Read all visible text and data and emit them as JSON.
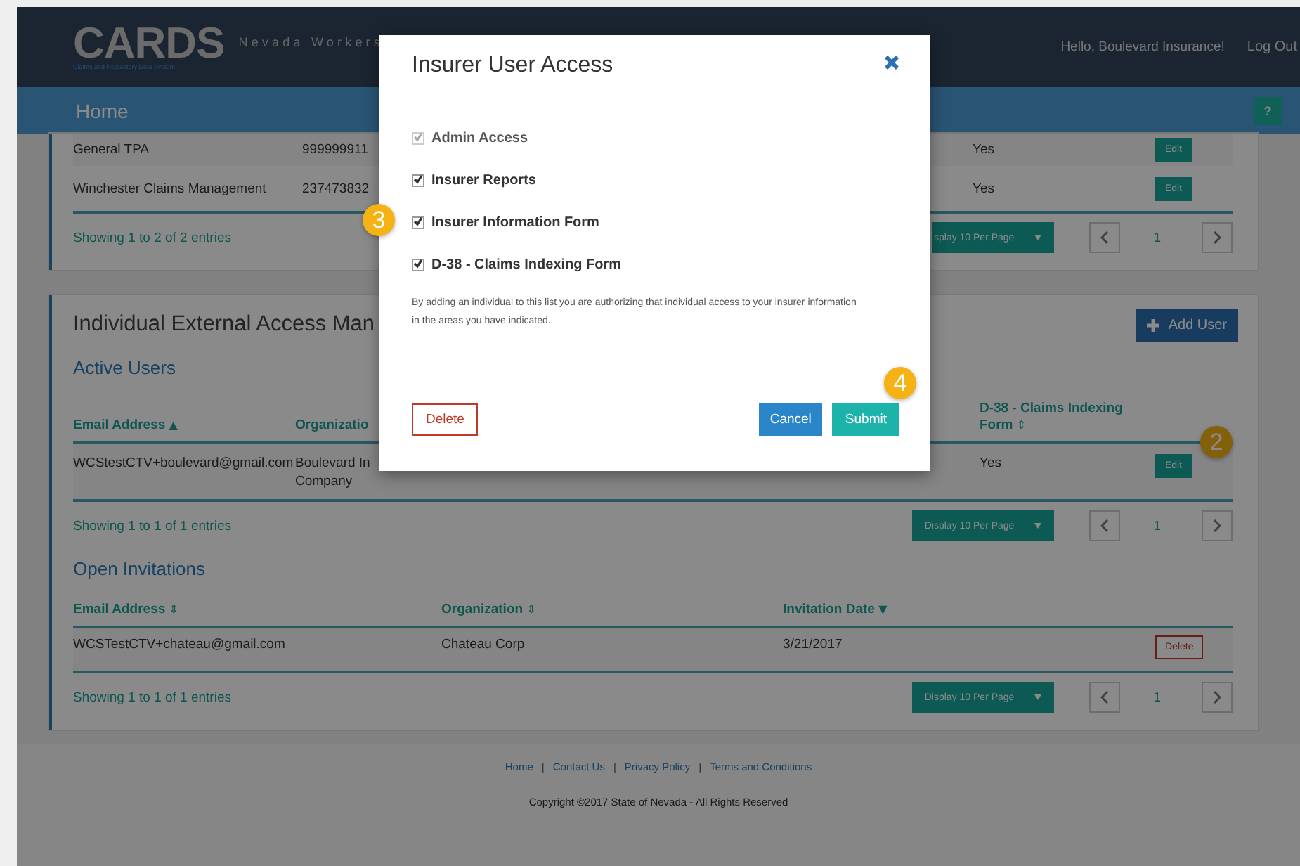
{
  "header": {
    "logo": "CARDS",
    "logo_subtitle": "Claims and Regulatory Data System",
    "site_title": "Nevada Workers",
    "greeting": "Hello, Boulevard Insurance!",
    "logout": "Log Out"
  },
  "nav": {
    "title": "Home",
    "help": "?"
  },
  "insurer_table": {
    "rows": [
      {
        "name": "General TPA",
        "number": "999999911",
        "access": "Yes",
        "action": "Edit"
      },
      {
        "name": "Winchester Claims Management",
        "number": "237473832",
        "access": "Yes",
        "action": "Edit"
      }
    ],
    "summary": "Showing 1 to 2 of 2 entries",
    "page_size": "splay 10 Per Page",
    "page": "1"
  },
  "external_access": {
    "title": "Individual External Access Man",
    "add_button": "Add User",
    "active_users": {
      "heading": "Active Users",
      "columns": [
        {
          "label": "Email Address",
          "sort_icon": "▲"
        },
        {
          "label": "Organizatio"
        },
        {
          "label": "D-38 - Claims Indexing Form",
          "sort_icon": "⇕"
        }
      ],
      "rows": [
        {
          "email": "WCStestCTV+boulevard@gmail.com",
          "organization": [
            "Boulevard In",
            "Company"
          ],
          "d38": "Yes",
          "action": "Edit",
          "callout": "2"
        }
      ],
      "summary": "Showing 1 to 1 of 1 entries",
      "page_size": "Display 10 Per Page",
      "page": "1"
    },
    "open_invitations": {
      "heading": "Open Invitations",
      "columns": [
        {
          "label": "Email Address",
          "sort_icon": "⇕"
        },
        {
          "label": "Organization",
          "sort_icon": "⇕"
        },
        {
          "label": "Invitation Date",
          "sort_icon": "▼"
        }
      ],
      "rows": [
        {
          "email": "WCSTestCTV+chateau@gmail.com",
          "organization": "Chateau Corp",
          "date": "3/21/2017",
          "action": "Delete"
        }
      ],
      "summary": "Showing 1 to 1 of 1 entries",
      "page_size": "Display 10 Per Page",
      "page": "1"
    }
  },
  "footer": {
    "links": [
      "Home",
      "Contact Us",
      "Privacy Policy",
      "Terms and Conditions"
    ],
    "separator": "|",
    "copyright": "Copyright ©2017 State of Nevada - All Rights Reserved"
  },
  "modal": {
    "title": "Insurer User Access",
    "options": [
      {
        "label": "Admin Access",
        "checked": true,
        "disabled": true
      },
      {
        "label": "Insurer Reports",
        "checked": true,
        "disabled": false
      },
      {
        "label": "Insurer Information Form",
        "checked": true,
        "disabled": false,
        "callout": "3"
      },
      {
        "label": "D-38 - Claims Indexing Form",
        "checked": true,
        "disabled": false
      }
    ],
    "note": "By adding an individual to this list you are authorizing that individual access to your insurer information in the areas you have indicated.",
    "delete": "Delete",
    "cancel": "Cancel",
    "submit": "Submit",
    "submit_callout": "4"
  }
}
